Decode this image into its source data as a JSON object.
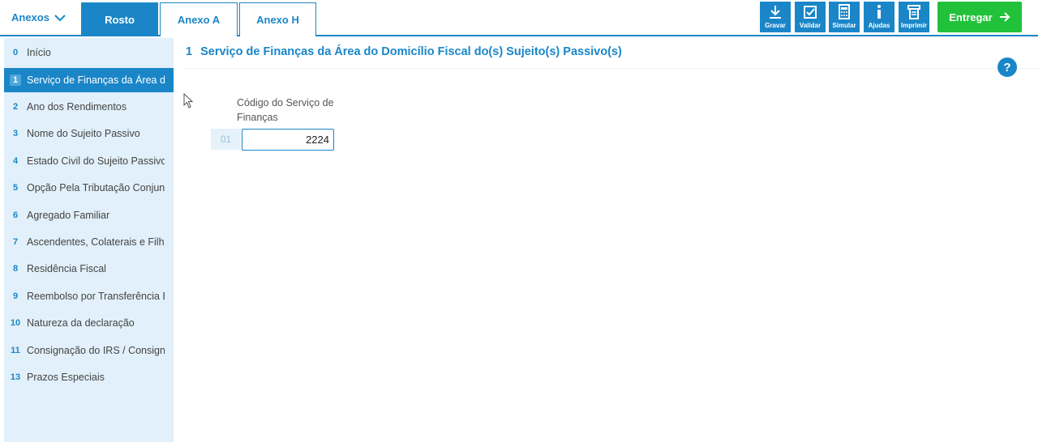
{
  "header": {
    "anexos_label": "Anexos",
    "tabs": [
      {
        "label": "Rosto",
        "active": true
      },
      {
        "label": "Anexo A",
        "active": false
      },
      {
        "label": "Anexo H",
        "active": false
      }
    ],
    "toolbar": {
      "gravar": "Gravar",
      "validar": "Validar",
      "simular": "Simular",
      "ajudas": "Ajudas",
      "imprimir": "Imprimir"
    },
    "entregar_label": "Entregar"
  },
  "sidebar": {
    "items": [
      {
        "num": "0",
        "label": "Início"
      },
      {
        "num": "1",
        "label": "Serviço de Finanças da Área do Domicílio Fiscal",
        "active": true
      },
      {
        "num": "2",
        "label": "Ano dos Rendimentos"
      },
      {
        "num": "3",
        "label": "Nome do Sujeito Passivo"
      },
      {
        "num": "4",
        "label": "Estado Civil do Sujeito Passivo"
      },
      {
        "num": "5",
        "label": "Opção Pela Tributação Conjunta"
      },
      {
        "num": "6",
        "label": "Agregado Familiar"
      },
      {
        "num": "7",
        "label": "Ascendentes, Colaterais e Filhos"
      },
      {
        "num": "8",
        "label": "Residência Fiscal"
      },
      {
        "num": "9",
        "label": "Reembolso por Transferência Bancária"
      },
      {
        "num": "10",
        "label": "Natureza da declaração"
      },
      {
        "num": "11",
        "label": "Consignação do IRS / Consignação do IVA"
      },
      {
        "num": "13",
        "label": "Prazos Especiais"
      }
    ]
  },
  "main": {
    "section_num": "1",
    "section_title": "Serviço de Finanças da Área do Domicílio Fiscal do(s) Sujeito(s) Passivo(s)",
    "help": "?",
    "field": {
      "label": "Código do Serviço de Finanças",
      "row": "01",
      "value": "2224"
    }
  },
  "colors": {
    "accent": "#1a86c8",
    "sidebar_bg": "#e1f0fa",
    "entregar_bg": "#21c23a"
  }
}
